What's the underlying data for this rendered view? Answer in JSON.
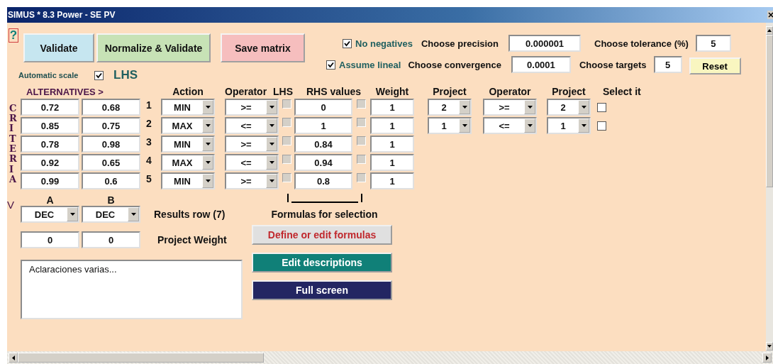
{
  "window": {
    "title": "SIMUS * 8.3 Power - SE PV"
  },
  "help_button": "?",
  "buttons": [
    {
      "label": "Validate",
      "kind": "validate"
    },
    {
      "label": "Normalize & Validate",
      "kind": "normalize"
    },
    {
      "label": "Save matrix",
      "kind": "save"
    }
  ],
  "options": [
    {
      "label": "No negatives",
      "checked": true
    },
    {
      "label": "Assume lineal",
      "checked": true
    }
  ],
  "settings": [
    {
      "label": "Choose precision",
      "value": "0.000001"
    },
    {
      "label": "Choose tolerance (%)",
      "value": "5"
    },
    {
      "label": "Choose convergence",
      "value": "0.0001"
    },
    {
      "label": "Choose targets",
      "value": "5"
    }
  ],
  "reset_button": "Reset",
  "automatic_scale": {
    "label": "Automatic scale",
    "checked": true
  },
  "lhs_label": "LHS",
  "headers": {
    "alternatives": "ALTERNATIVES  >",
    "action": "Action",
    "operator": "Operator",
    "lhs": "LHS",
    "rhs_values": "RHS  values",
    "weight": "Weight",
    "project": "Project",
    "operator_2": "Operator",
    "project_2": "Project",
    "select_it": "Select it"
  },
  "criteria_label": "CRITERIA",
  "criteria": [
    {
      "values": [
        "0.72",
        "0.68"
      ],
      "number": "1",
      "action": "MIN",
      "operator": ">=",
      "lhs": {
        "checked": false,
        "disabled": true
      },
      "rhs": "0",
      "rhs_check": {
        "checked": false,
        "disabled": true
      },
      "weight": "1"
    },
    {
      "values": [
        "0.85",
        "0.75"
      ],
      "number": "2",
      "action": "MAX",
      "operator": "<=",
      "lhs": {
        "checked": false,
        "disabled": true
      },
      "rhs": "1",
      "rhs_check": {
        "checked": false,
        "disabled": true
      },
      "weight": "1"
    },
    {
      "values": [
        "0.78",
        "0.98"
      ],
      "number": "3",
      "action": "MIN",
      "operator": ">=",
      "lhs": {
        "checked": false,
        "disabled": true
      },
      "rhs": "0.84",
      "rhs_check": {
        "checked": false,
        "disabled": true
      },
      "weight": "1"
    },
    {
      "values": [
        "0.92",
        "0.65"
      ],
      "number": "4",
      "action": "MAX",
      "operator": "<=",
      "lhs": {
        "checked": false,
        "disabled": true
      },
      "rhs": "0.94",
      "rhs_check": {
        "checked": false,
        "disabled": true
      },
      "weight": "1"
    },
    {
      "values": [
        "0.99",
        "0.6"
      ],
      "number": "5",
      "action": "MIN",
      "operator": ">=",
      "lhs": {
        "checked": false,
        "disabled": true
      },
      "rhs": "0.8",
      "rhs_check": {
        "checked": false,
        "disabled": true
      },
      "weight": "1"
    }
  ],
  "selection_rules": [
    {
      "project_a": "2",
      "operator": ">=",
      "project_b": "2",
      "checked": false
    },
    {
      "project_a": "1",
      "operator": "<=",
      "project_b": "1",
      "checked": false
    }
  ],
  "alternatives": [
    {
      "name": "A",
      "result": "DEC",
      "weight": "0"
    },
    {
      "name": "B",
      "result": "DEC",
      "weight": "0"
    }
  ],
  "v_label": "V",
  "results_row_label": "Results row (7)",
  "formulas_label": "Formulas for selection",
  "project_weight_label": "Project Weight",
  "formula_buttons": [
    {
      "label": "Define or edit formulas",
      "kind": "define"
    },
    {
      "label": "Edit descriptions",
      "kind": "edit"
    },
    {
      "label": "Full screen",
      "kind": "fullscreen"
    }
  ],
  "notes": "Aclaraciones varias..."
}
